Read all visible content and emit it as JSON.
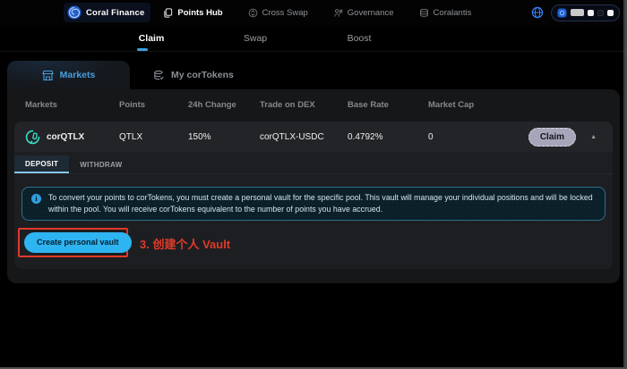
{
  "topnav": {
    "brand": "Coral Finance",
    "items": [
      {
        "label": "Points Hub",
        "active": true
      },
      {
        "label": "Cross Swap",
        "active": false
      },
      {
        "label": "Governance",
        "active": false
      },
      {
        "label": "Coralantis",
        "active": false
      }
    ]
  },
  "subnav": {
    "tabs": [
      {
        "label": "Claim",
        "active": true
      },
      {
        "label": "Swap",
        "active": false
      },
      {
        "label": "Boost",
        "active": false
      }
    ]
  },
  "panel": {
    "tabs": [
      {
        "label": "Markets",
        "active": true
      },
      {
        "label": "My corTokens",
        "active": false
      }
    ],
    "table": {
      "headers": [
        "Markets",
        "Points",
        "24h Change",
        "Trade on DEX",
        "Base Rate",
        "Market Cap"
      ],
      "row": {
        "market": "corQTLX",
        "points": "QTLX",
        "change_24h": "150%",
        "trade_on_dex": "corQTLX-USDC",
        "base_rate": "0.4792%",
        "market_cap": "0",
        "claim_label": "Claim"
      }
    },
    "detail": {
      "tabs": [
        {
          "label": "DEPOSIT",
          "active": true
        },
        {
          "label": "WITHDRAW",
          "active": false
        }
      ],
      "info_text": "To convert your points to corTokens, you must create a personal vault for the specific pool. This vault will manage your individual positions and will be locked within the pool. You will receive corTokens equivalent to the number of points you have accrued.",
      "create_button_label": "Create personal vault"
    }
  },
  "annotation": {
    "step_label": "3. 创建个人 Vault"
  },
  "icons": {
    "info_glyph": "i",
    "collapse_glyph": "▲"
  },
  "colors": {
    "accent_blue": "#2fb4f2",
    "tab_blue": "#479fdb",
    "annotation_red": "#e03a2a",
    "token_teal": "#35e0c8",
    "claim_pill": "#a6a6ba",
    "info_border": "#2d7091"
  }
}
